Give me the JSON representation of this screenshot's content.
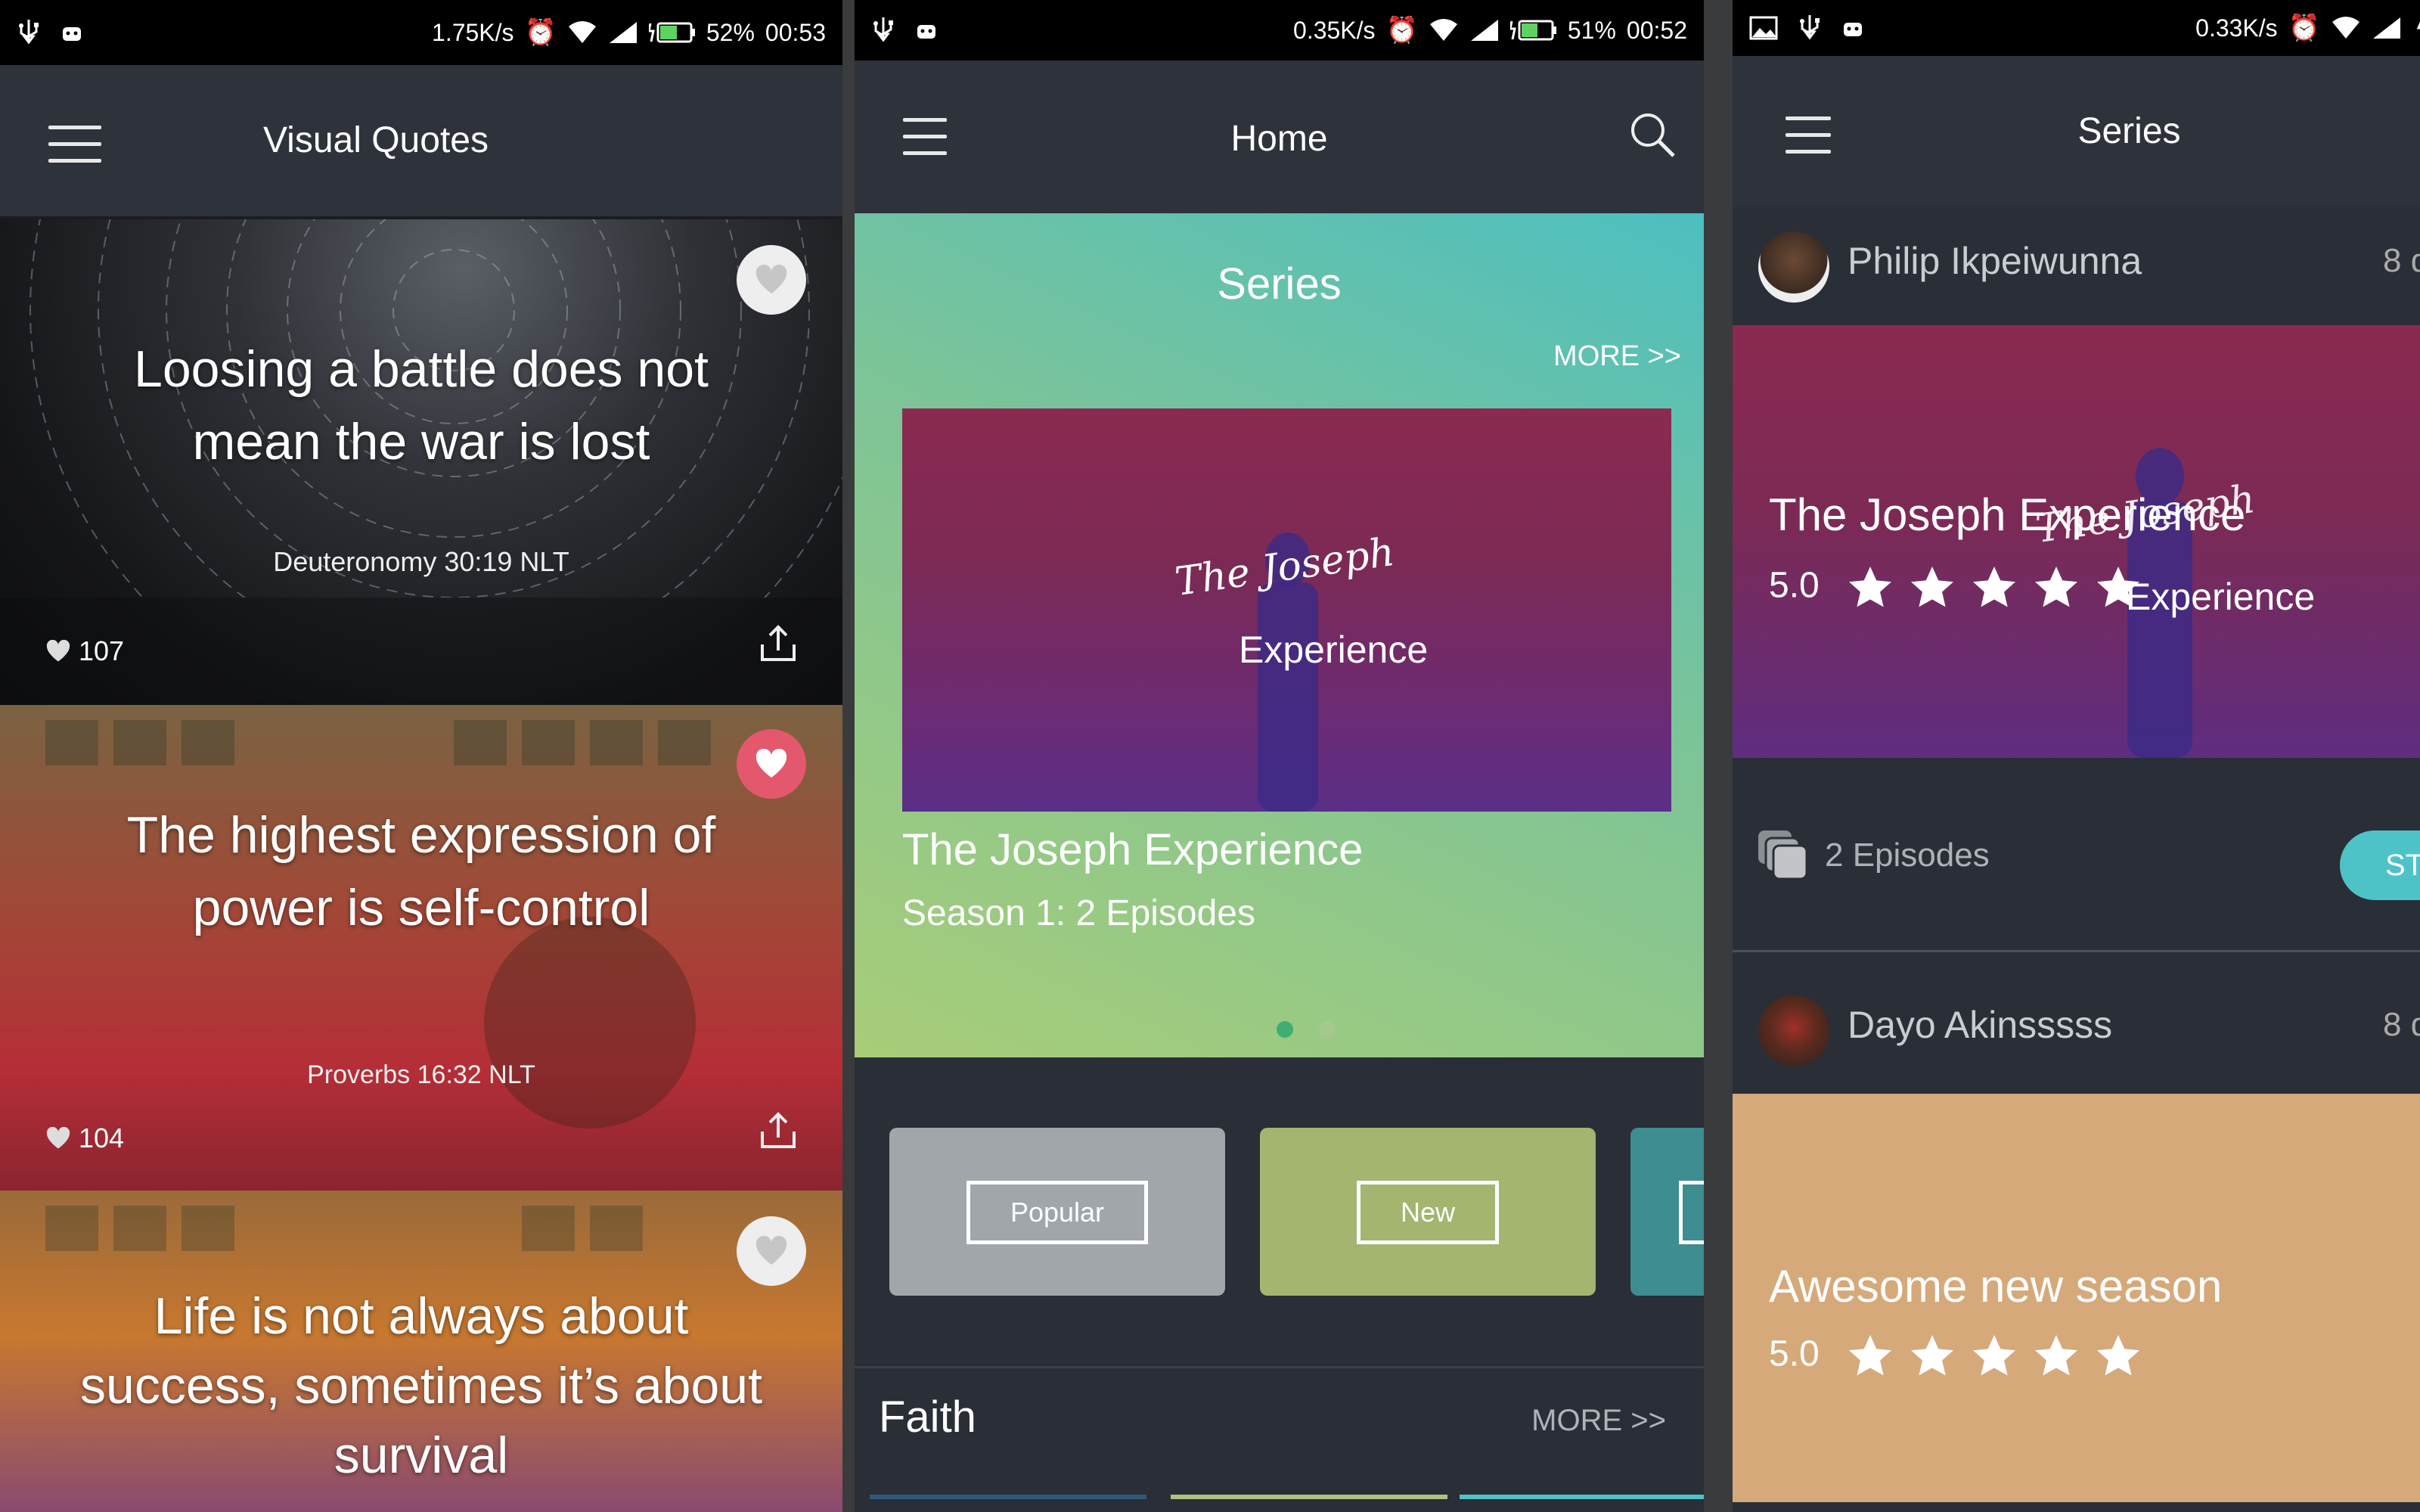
{
  "screens": [
    {
      "status": {
        "speed": "1.75K/s",
        "battery": "52%",
        "time": "00:53"
      },
      "app_title": "Visual Quotes",
      "quotes": [
        {
          "text": "Loosing a battle does not mean the war is lost",
          "ref": "Deuteronomy 30:19 NLT",
          "likes": "107",
          "liked": false
        },
        {
          "text": "The highest expression of power is self-control",
          "ref": "Proverbs 16:32 NLT",
          "likes": "104",
          "liked": true
        },
        {
          "text": "Life is not always about success, sometimes it’s about survival",
          "ref": "",
          "likes": "",
          "liked": false
        }
      ]
    },
    {
      "status": {
        "speed": "0.35K/s",
        "battery": "51%",
        "time": "00:52"
      },
      "app_title": "Home",
      "featured": {
        "section_title": "Series",
        "more": "MORE >>",
        "artwork_script": "The Joseph",
        "artwork_word": "Experience",
        "item_title": "The Joseph Experience",
        "item_subtitle": "Season 1: 2 Episodes",
        "carousel_active": 1
      },
      "categories": [
        {
          "label": "Popular",
          "color": "#a1a6ab"
        },
        {
          "label": "New",
          "color": "#a3b56f"
        },
        {
          "label": "",
          "color": "#3d8d91"
        }
      ],
      "faith": {
        "title": "Faith",
        "more": "MORE >>"
      }
    },
    {
      "status": {
        "speed": "0.33K/s",
        "battery": ""
      },
      "app_title": "Series",
      "posts": [
        {
          "user": "Philip Ikpeiwunna",
          "time_prefix": "8 d",
          "title": "The Joseph Experience",
          "rating": "5.0",
          "episodes": "2 Episodes",
          "action": "ST",
          "artwork_script": "The Joseph",
          "artwork_word": "Experience"
        },
        {
          "user": "Dayo Akinsssss",
          "time_prefix": "8 d",
          "title": "Awesome new season",
          "rating": "5.0"
        }
      ]
    }
  ],
  "colors": {
    "accent_teal": "#4ec3c7",
    "like_red": "#e3586c",
    "page_bg": "#2a2e37",
    "appbar_bg": "#2e323b"
  }
}
